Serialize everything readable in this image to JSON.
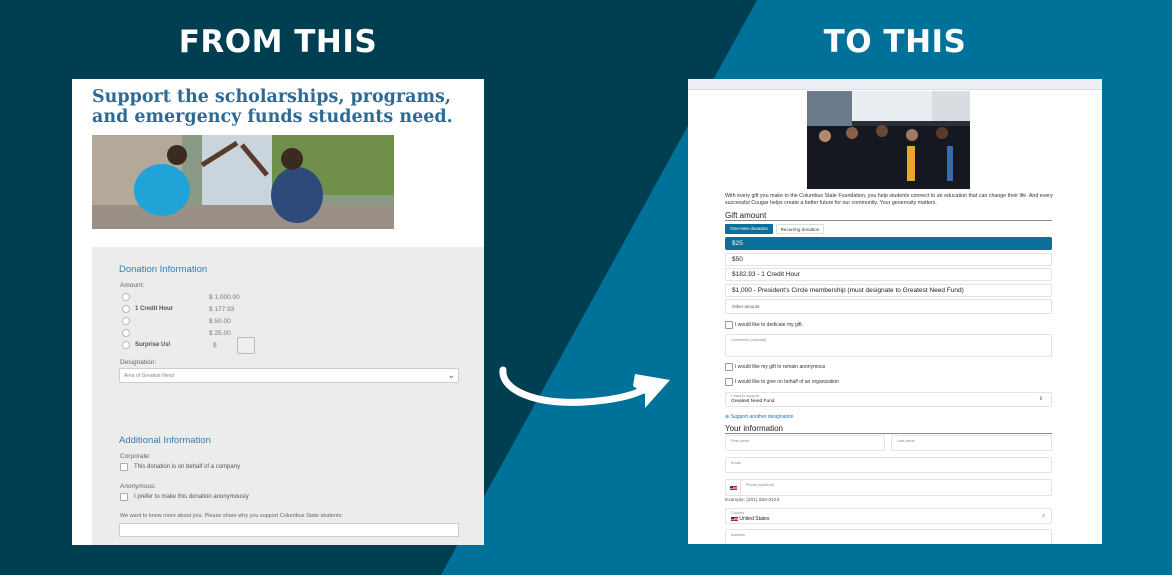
{
  "headings": {
    "left": "FROM THIS",
    "right": "TO THIS"
  },
  "colors": {
    "dark_bg": "#003f52",
    "light_bg": "#007199",
    "accent": "#0a6f9a",
    "old_title": "#2d6b94",
    "old_section": "#2f7fb4"
  },
  "old_form": {
    "title": "Support the scholarships, programs, and emergency funds students need.",
    "donation_section": "Donation Information",
    "amount_label": "Amount:",
    "options": [
      {
        "label": "",
        "amount": "$ 1,000.00"
      },
      {
        "label": "1 Credit Hour",
        "amount": "$ 177.93"
      },
      {
        "label": "",
        "amount": "$ 50.00"
      },
      {
        "label": "",
        "amount": "$ 25.00"
      },
      {
        "label": "Surprise Us!",
        "amount": "$"
      }
    ],
    "designation_label": "Designation:",
    "designation_value": "Area of Greatest Need",
    "additional_section": "Additional Information",
    "corporate_label": "Corporate:",
    "corporate_check": "This donation is on behalf of a company",
    "anonymous_label": "Anonymous:",
    "anonymous_check": "I prefer to make this donation anonymously",
    "why_label": "We want to know more about you. Please share why you support Columbus State students:"
  },
  "new_form": {
    "intro": "With every gift you make to the Columbus State Foundation, you help students connect to an education that can change their life. And every successful Cougar helps create a better future for our community. Your generosity matters.",
    "gift_amount_title": "Gift amount",
    "tabs": [
      {
        "label": "One-time donation",
        "active": true
      },
      {
        "label": "Recurring donation",
        "active": false
      }
    ],
    "amounts": [
      {
        "label": "$25",
        "selected": true
      },
      {
        "label": "$50",
        "selected": false
      },
      {
        "label": "$182.93 - 1 Credit Hour",
        "selected": false
      },
      {
        "label": "$1,000 - President's Circle membership (must designate to Greatest Need Fund)",
        "selected": false
      }
    ],
    "other_amount_placeholder": "Other amount",
    "dedicate_check": "I would like to dedicate my gift.",
    "comments_placeholder": "Comments (optional)",
    "anonymous_check": "I would like my gift to remain anonymous",
    "organization_check": "I would like to give on behalf of an organization",
    "support_label": "I want to support",
    "support_value": "Greatest Need Fund",
    "support_another": "Support another designation",
    "your_info_title": "Your information",
    "first_name": "First name",
    "last_name": "Last name",
    "email": "Email",
    "phone": "Phone (optional)",
    "phone_example": "Example: (201) 555-0123",
    "country_label": "Country",
    "country_value": "United States",
    "address": "Address"
  }
}
